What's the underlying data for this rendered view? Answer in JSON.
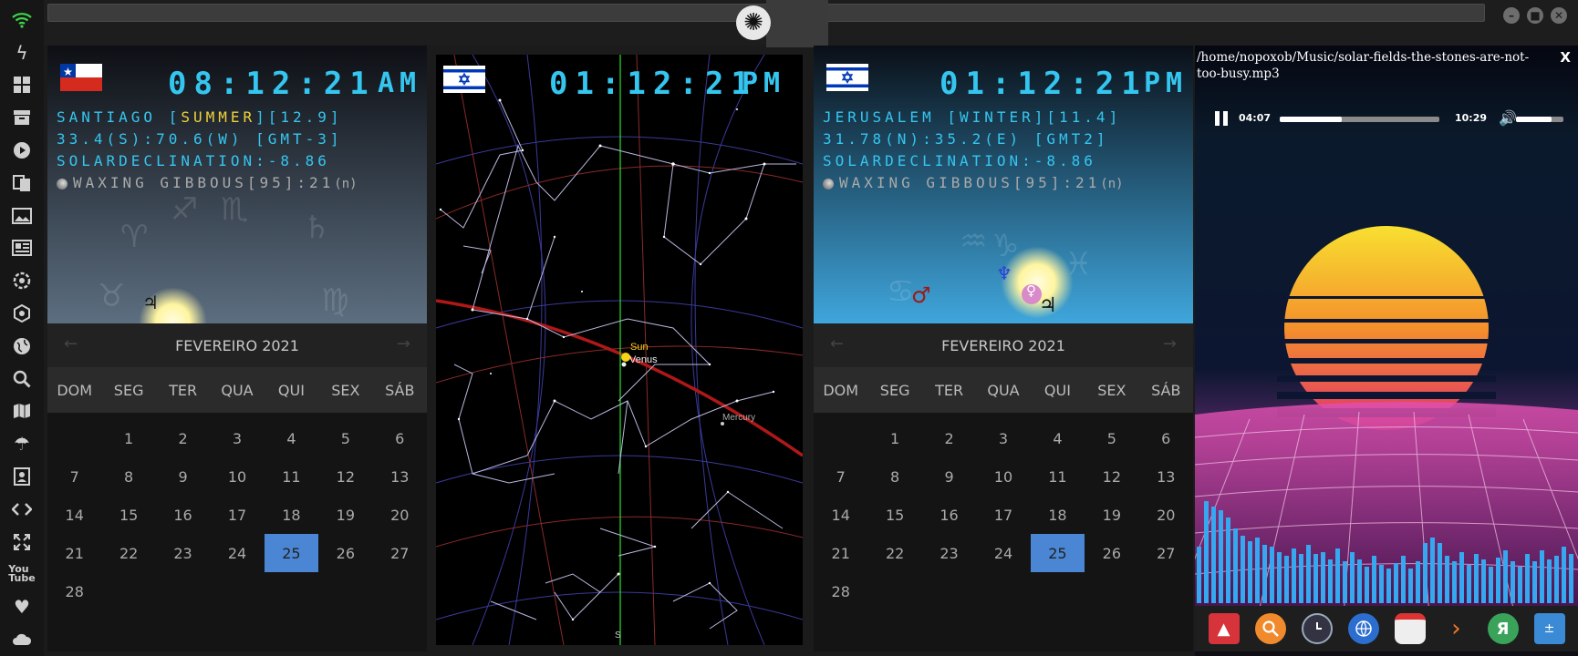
{
  "sidebar": {
    "icons": [
      "wifi-icon",
      "flash-icon",
      "windows-icon",
      "archive-icon",
      "play-icon",
      "translate-icon",
      "image-icon",
      "news-icon",
      "settings-icon",
      "hexagon-icon",
      "globe-icon",
      "search-icon",
      "map-icon",
      "umbrella-icon",
      "contacts-icon",
      "code-icon",
      "fullscreen-icon",
      "youtube-icon",
      "heart-icon",
      "cloud-icon"
    ]
  },
  "clocks": [
    {
      "flag": "chile",
      "time": "08:12:21",
      "ampm": "AM",
      "location_pre": "SANTIAGO [",
      "season": "SUMMER",
      "location_post": "][12.9]",
      "coords": "33.4(S):70.6(W) [GMT-3]",
      "declination": "SOLARDECLINATION:-8.86",
      "moon": "WAXING GIBBOUS[95]:21",
      "moon_suffix": "(n)",
      "bg_top": "#0d0f14",
      "bg_bottom": "#5c6e80"
    },
    {
      "flag": "israel",
      "time": "01:12:21",
      "ampm": "PM",
      "location_pre": "JERUSALEM [",
      "season": "WINTER",
      "location_post": "][11.4]",
      "coords": "31.78(N):35.2(E) [GMT2]",
      "declination": "SOLARDECLINATION:-8.86",
      "moon": "WAXING GIBBOUS[95]:21",
      "moon_suffix": "(n)",
      "bg_top": "#0a0f17",
      "bg_bottom": "#3fa6dc"
    }
  ],
  "starmap": {
    "flag": "israel",
    "time": "01:12:21",
    "ampm": "PM",
    "labels": {
      "sun": "Sun",
      "venus": "Venus",
      "mercury": "Mercury",
      "south": "S"
    }
  },
  "calendar": {
    "month": "FEVEREIRO 2021",
    "prev": "←",
    "next": "→",
    "weekdays": [
      "DOM",
      "SEG",
      "TER",
      "QUA",
      "QUI",
      "SEX",
      "SÁB"
    ],
    "days": [
      "",
      "1",
      "2",
      "3",
      "4",
      "5",
      "6",
      "7",
      "8",
      "9",
      "10",
      "11",
      "12",
      "13",
      "14",
      "15",
      "16",
      "17",
      "18",
      "19",
      "20",
      "21",
      "22",
      "23",
      "24",
      "25",
      "26",
      "27",
      "28"
    ],
    "today": "25"
  },
  "media": {
    "path": "/home/nopoxob/Music/solar-fields-the-stones-are-not-too-busy.mp3",
    "close": "X",
    "current_time": "04:07",
    "total_time": "10:29",
    "progress": 0.39,
    "volume": 0.75
  },
  "dock": [
    "arch-icon",
    "search-icon",
    "clock-icon",
    "globe-icon",
    "calendar-icon",
    "arrow-icon",
    "yandex-icon",
    "calculator-icon"
  ],
  "window_buttons": [
    "minimize",
    "maximize",
    "close"
  ]
}
